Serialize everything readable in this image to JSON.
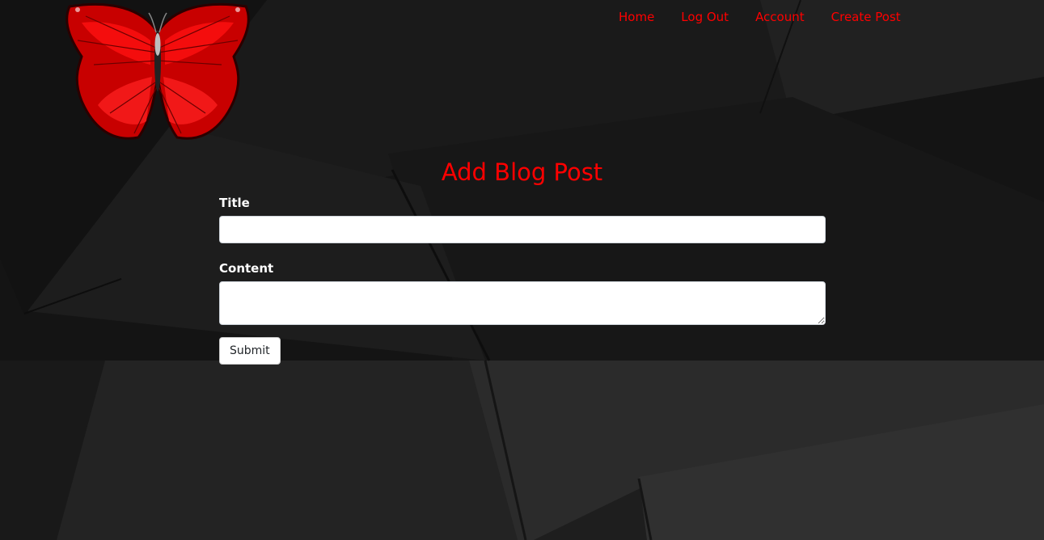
{
  "colors": {
    "accent": "#ff0000",
    "label_text": "#ffffff",
    "background": "#1c1c1c"
  },
  "logo": {
    "icon": "red-butterfly-icon"
  },
  "nav": {
    "items": [
      {
        "label": "Home"
      },
      {
        "label": "Log Out"
      },
      {
        "label": "Account"
      },
      {
        "label": "Create Post"
      }
    ]
  },
  "page": {
    "title": "Add Blog Post"
  },
  "form": {
    "title_label": "Title",
    "title_value": "",
    "content_label": "Content",
    "content_value": "",
    "submit_label": "Submit"
  }
}
